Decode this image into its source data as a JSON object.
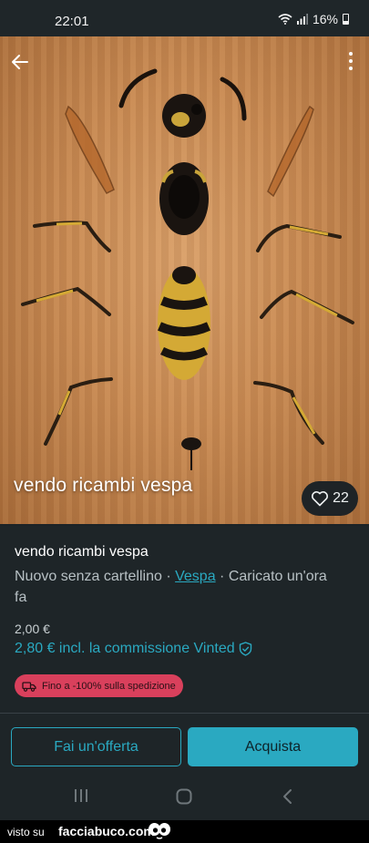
{
  "status_bar": {
    "time": "22:01",
    "battery": "16%",
    "icons": [
      "wifi-icon",
      "signal-icon",
      "battery-icon"
    ]
  },
  "photo": {
    "caption": "vendo ricambi vespa",
    "likes": "22"
  },
  "item": {
    "title": "vendo ricambi vespa",
    "condition": "Nuovo senza cartellino",
    "separator": "·",
    "brand": "Vespa",
    "uploaded": "Caricato un'ora fa",
    "price": "2,00 €",
    "price_with_fee": "2,80 € incl. la commissione Vinted",
    "promo": "Fino a -100% sulla spedizione"
  },
  "actions": {
    "offer_label": "Fai un'offerta",
    "buy_label": "Acquista"
  },
  "watermark": {
    "prefix": "visto su",
    "site": "facciabuco.com"
  },
  "colors": {
    "accent": "#2aa9c1",
    "promo": "#d9405c",
    "background": "#1e2528"
  }
}
